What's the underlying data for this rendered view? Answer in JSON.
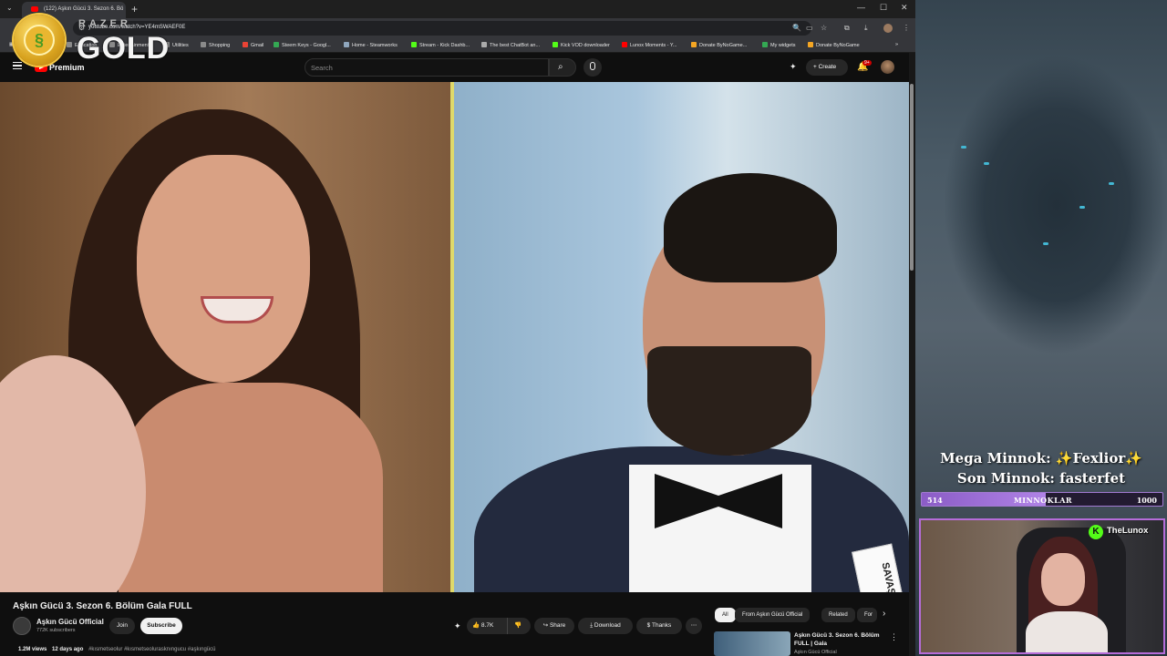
{
  "browser": {
    "tab_title": "(122) Aşkın Gücü 3. Sezon 6. Bö",
    "url": "youtube.com/watch?v=YE4mSWAEF0E",
    "bookmarks": [
      {
        "label": "Education",
        "color": "#5f6368"
      },
      {
        "label": "Entertainment",
        "color": "#5f6368"
      },
      {
        "label": "Utilities",
        "color": "#5f6368"
      },
      {
        "label": "Shopping",
        "color": "#5f6368"
      },
      {
        "label": "Gmail",
        "color": "#ea4335"
      },
      {
        "label": "Steem Keys - Googl...",
        "color": "#34a853"
      },
      {
        "label": "Home - Steamworks",
        "color": "#1b2838"
      },
      {
        "label": "Stream - Kick Dashb...",
        "color": "#53fc18"
      },
      {
        "label": "The best ChatBot an...",
        "color": "#aaaaaa"
      },
      {
        "label": "Kick VOD downloader",
        "color": "#53fc18"
      },
      {
        "label": "Lunox Moments - Y...",
        "color": "#ff0000"
      },
      {
        "label": "Donate ByNoGame...",
        "color": "#f5a623"
      },
      {
        "label": "My widgets",
        "color": "#34a853"
      },
      {
        "label": "Donate ByNoGame",
        "color": "#f5a623"
      }
    ]
  },
  "overlay": {
    "brand_top": "RAZER",
    "brand_main": "GOLD"
  },
  "youtube": {
    "brand": "Premium",
    "search_placeholder": "Search",
    "create_label": "Create",
    "notif_count": "9+"
  },
  "video": {
    "title": "Aşkın Gücü 3. Sezon 6. Bölüm Gala FULL",
    "name_tag": "SAVAŞ",
    "channel_name": "Aşkın Gücü Official",
    "subscribers": "772K subscribers",
    "join_label": "Join",
    "subscribe_label": "Subscribe",
    "likes": "8.7K",
    "share_label": "Share",
    "download_label": "Download",
    "thanks_label": "Thanks",
    "views": "1.2M views",
    "age": "12 days ago",
    "hashtags": "#kısmetseolur #kısmetseolurasknıngucu #aşkıngücü"
  },
  "sidebar": {
    "chips": [
      "All",
      "From Aşkın Gücü Official",
      "Related",
      "For"
    ],
    "rec_title": "Aşkın Gücü 3. Sezon 6. Bölüm FULL | Gala",
    "rec_channel": "Aşkın Gücü Official"
  },
  "stream": {
    "mega_line": "Mega Minnok: ✨Fexlior✨",
    "son_line": "Son Minnok: fasterfet",
    "goal_current": "514",
    "goal_label": "MINNOKLAR",
    "goal_target": "1000",
    "goal_fraction": 0.514,
    "streamer_name": "TheLunox",
    "accent": "#b56cd9"
  }
}
